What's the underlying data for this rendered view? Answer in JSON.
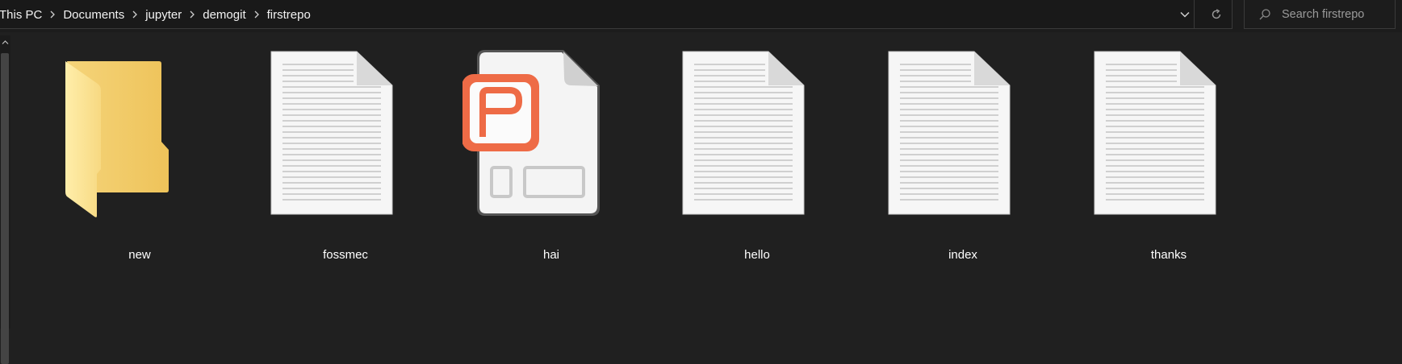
{
  "address_bar": {
    "breadcrumbs": [
      "This PC",
      "Documents",
      "jupyter",
      "demogit",
      "firstrepo"
    ],
    "dropdown_icon": "chevron-down-icon",
    "refresh_icon": "refresh-icon"
  },
  "search": {
    "placeholder": "Search firstrepo",
    "icon": "search-icon"
  },
  "files": [
    {
      "name": "new",
      "type": "folder"
    },
    {
      "name": "fossmec",
      "type": "text-document"
    },
    {
      "name": "hai",
      "type": "powerpoint-document"
    },
    {
      "name": "hello",
      "type": "text-document"
    },
    {
      "name": "index",
      "type": "text-document"
    },
    {
      "name": "thanks",
      "type": "text-document"
    }
  ],
  "colors": {
    "background": "#202020",
    "folder": "#f3cf6f",
    "powerpoint_accent": "#ed6c47"
  }
}
